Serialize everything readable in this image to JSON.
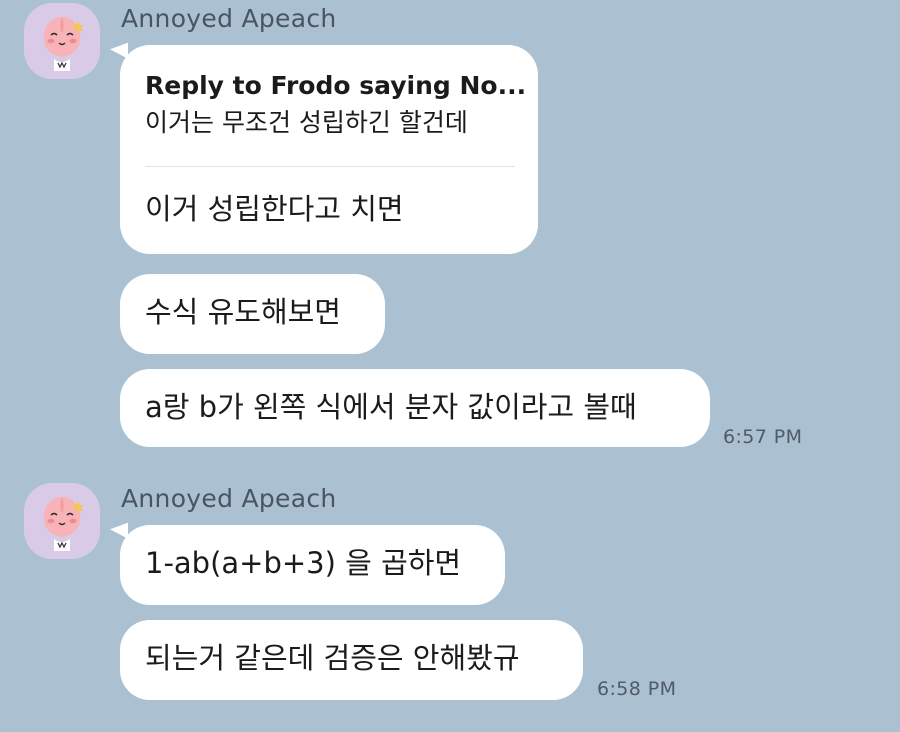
{
  "groups": [
    {
      "sender": "Annoyed Apeach",
      "avatar_icon": "apeach-avatar-icon",
      "reply": {
        "title": "Reply to Frodo saying No...",
        "quote": "이거는 무조건 성립하긴 할건데"
      },
      "messages": [
        "이거 성립한다고 치면",
        "수식 유도해보면",
        "a랑 b가 왼쪽 식에서 분자 값이라고 볼때"
      ],
      "time": "6:57 PM"
    },
    {
      "sender": "Annoyed Apeach",
      "avatar_icon": "apeach-avatar-icon",
      "messages": [
        "1-ab(a+b+3) 을 곱하면",
        "되는거 같은데 검증은 안해봤규"
      ],
      "time": "6:58 PM"
    }
  ],
  "colors": {
    "background": "#abc1d1",
    "bubble": "#ffffff",
    "avatar_bg": "#d9cbe8",
    "peach": "#f7b3b6"
  }
}
